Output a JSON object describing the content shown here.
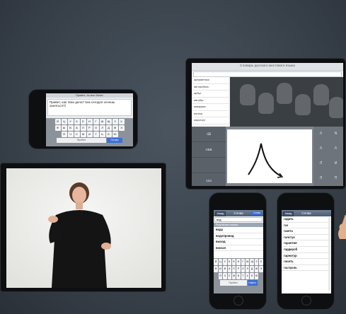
{
  "landscape_phone": {
    "title": "Привет, ты все белят",
    "message": "Привет, как твои дела? Как сегодня хочешь заняться?|",
    "keyboard_rows": [
      [
        "Й",
        "Ц",
        "У",
        "К",
        "Е",
        "Н",
        "Г",
        "Ш",
        "Щ",
        "З",
        "Х"
      ],
      [
        "Ф",
        "Ы",
        "В",
        "А",
        "П",
        "Р",
        "О",
        "Л",
        "Д",
        "Ж",
        "Э"
      ],
      [
        "Я",
        "Ч",
        "С",
        "М",
        "И",
        "Т",
        "Ь",
        "Б",
        "Ю"
      ]
    ],
    "space_label": "Пробел",
    "done_label": "Готово"
  },
  "tablet": {
    "title": "Словарь русского жестового языка",
    "search_value": "",
    "list_items": [
      "арифметика",
      "автомобиль",
      "арбуз",
      "автобус",
      "аквариум",
      "аптека",
      "аэропорт"
    ],
    "side_keys": [
      "",
      "АБВ",
      "",
      "123"
    ],
    "candidates": [
      "Λ",
      "Ν",
      "Λ",
      "Λ",
      "Л",
      "И",
      "Л",
      "П"
    ]
  },
  "phone_left": {
    "nav_back": "Назад",
    "nav_title": "Слова",
    "nav_action": "Готово",
    "search_value": "вод",
    "section_header": "Результаты поиска",
    "words": [
      "вода",
      "водопровод",
      "выход",
      "вокзал"
    ],
    "keyboard_rows": [
      [
        "Й",
        "Ц",
        "У",
        "К",
        "Е",
        "Н",
        "Г",
        "Ш",
        "Щ",
        "З",
        "Х"
      ],
      [
        "Ф",
        "Ы",
        "В",
        "А",
        "П",
        "Р",
        "О",
        "Л",
        "Д",
        "Ж",
        "Э"
      ],
      [
        "Я",
        "Ч",
        "С",
        "М",
        "И",
        "Т",
        "Ь",
        "Б",
        "Ю"
      ]
    ],
    "space_label": "Пробел",
    "done_label": "Найти"
  },
  "phone_right": {
    "nav_back": "Назад",
    "nav_title": "Слова",
    "words": [
      "гадать",
      "газ",
      "газета",
      "галстук",
      "гарантия",
      "гардероб",
      "гарнитур",
      "гасить",
      "гастроль"
    ]
  },
  "colors": {
    "background": "#3a434c",
    "accent_blue": "#3d6fd6",
    "nav_bar": "#5d6d82"
  }
}
